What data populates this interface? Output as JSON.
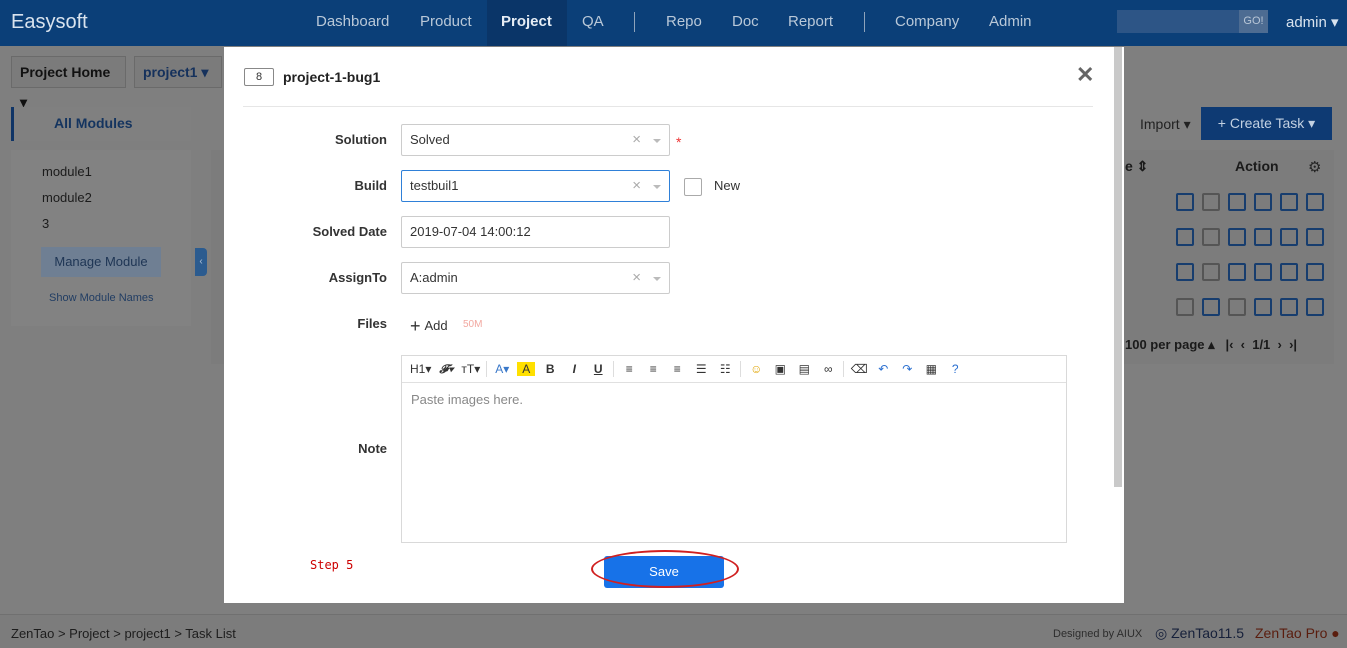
{
  "app": {
    "brand": "Easysoft",
    "nav": [
      "Dashboard",
      "Product",
      "Project",
      "QA",
      "Repo",
      "Doc",
      "Report",
      "Company",
      "Admin"
    ],
    "active_nav": "Project",
    "search_go": "GO!",
    "user": "admin"
  },
  "background": {
    "crumb_home": "Project Home",
    "crumb_project": "project1",
    "modules_tab": "All Modules",
    "modules": [
      "module1",
      "module2",
      "3"
    ],
    "manage_module": "Manage Module",
    "show_module_names": "Show Module Names",
    "import": "Import",
    "create_task": "Create Task",
    "action_header": "Action",
    "pager_text": "100 per page",
    "pager_pages": "1/1"
  },
  "footer": {
    "crumb": "ZenTao  >  Project  >  project1  >  Task List",
    "designed_by": "Designed by AIUX",
    "version": "ZenTao11.5",
    "pro": "ZenTao Pro"
  },
  "modal": {
    "bug_id": "8",
    "title": "project-1-bug1",
    "fields": {
      "solution": {
        "label": "Solution",
        "value": "Solved"
      },
      "build": {
        "label": "Build",
        "value": "testbuil1",
        "new_label": "New"
      },
      "solved_date": {
        "label": "Solved Date",
        "value": "2019-07-04 14:00:12"
      },
      "assign_to": {
        "label": "AssignTo",
        "value": "A:admin"
      },
      "files": {
        "label": "Files",
        "add_label": "Add",
        "size_limit": "50M"
      },
      "note": {
        "label": "Note",
        "placeholder": "Paste images here."
      }
    },
    "step_label": "Step 5",
    "save_label": "Save"
  }
}
